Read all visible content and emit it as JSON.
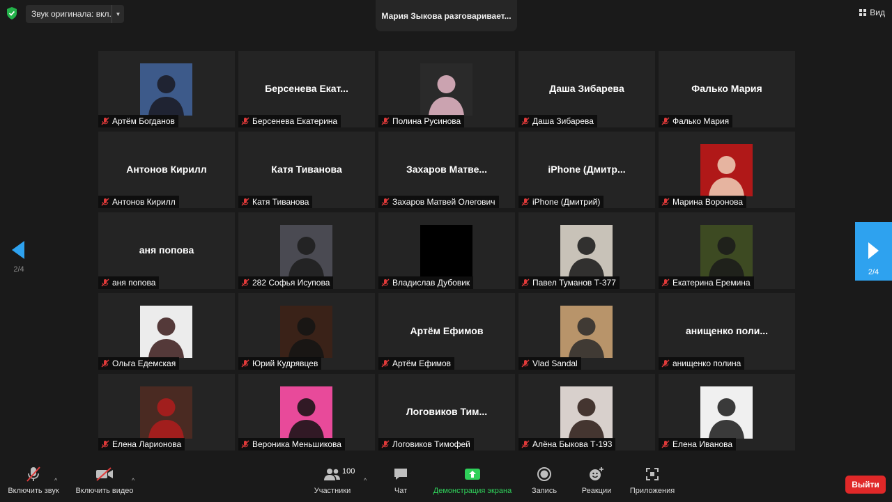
{
  "topbar": {
    "audio_label": "Звук оригинала: вкл.",
    "speaking": "Мария Зыкова разговаривает...",
    "view_label": "Вид"
  },
  "pagination": {
    "left": "2/4",
    "right": "2/4"
  },
  "participants": [
    {
      "name": "Артём Богданов",
      "display": "",
      "photo": true,
      "bg": "#3d5a8a",
      "fg": "#1a1a22"
    },
    {
      "name": "Берсенева Екатерина",
      "display": "Берсенева  Екат...",
      "photo": false
    },
    {
      "name": "Полина Русинова",
      "display": "",
      "photo": true,
      "bg": "#2a2a2a",
      "fg": "#e8b8c8"
    },
    {
      "name": "Даша Зибарева",
      "display": "Даша Зибарева",
      "photo": false
    },
    {
      "name": "Фалько Мария",
      "display": "Фалько Мария",
      "photo": false
    },
    {
      "name": "Антонов Кирилл",
      "display": "Антонов Кирилл",
      "photo": false
    },
    {
      "name": "Катя Тиванова",
      "display": "Катя Тиванова",
      "photo": false
    },
    {
      "name": "Захаров Матвей Олегович",
      "display": "Захаров  Матве...",
      "photo": false
    },
    {
      "name": "iPhone (Дмитрий)",
      "display": "iPhone  (Дмитр...",
      "photo": false
    },
    {
      "name": "Марина Воронова",
      "display": "",
      "photo": true,
      "bg": "#b01818",
      "fg": "#f0d0b8"
    },
    {
      "name": "аня попова",
      "display": "аня попова",
      "photo": false
    },
    {
      "name": "282 Софья Исупова",
      "display": "",
      "photo": true,
      "bg": "#4a4a52",
      "fg": "#1c1c1c"
    },
    {
      "name": "Владислав Дубовик",
      "display": "",
      "photo": true,
      "bg": "#000000",
      "fg": "#000000"
    },
    {
      "name": "Павел Туманов Т-377",
      "display": "",
      "photo": true,
      "bg": "#c8c2b8",
      "fg": "#161616"
    },
    {
      "name": "Екатерина Еремина",
      "display": "",
      "photo": true,
      "bg": "#3d4a22",
      "fg": "#1a1a1a"
    },
    {
      "name": "Ольга Едемская",
      "display": "",
      "photo": true,
      "bg": "#ececec",
      "fg": "#3a1a1a"
    },
    {
      "name": "Юрий Кудрявцев",
      "display": "",
      "photo": true,
      "bg": "#3a2218",
      "fg": "#141414"
    },
    {
      "name": "Артём Ефимов",
      "display": "Артём Ефимов",
      "photo": false
    },
    {
      "name": "Vlad Sandal",
      "display": "",
      "photo": true,
      "bg": "#b8946a",
      "fg": "#2a2a2a"
    },
    {
      "name": "анищенко полина",
      "display": "анищенко  поли...",
      "photo": false
    },
    {
      "name": "Елена Ларионова",
      "display": "",
      "photo": true,
      "bg": "#4a2a22",
      "fg": "#b01c1c"
    },
    {
      "name": "Вероника Меньшикова",
      "display": "",
      "photo": true,
      "bg": "#e84a9a",
      "fg": "#111111"
    },
    {
      "name": "Логовиков Тимофей",
      "display": "Логовиков  Тим...",
      "photo": false
    },
    {
      "name": "Алёна Быкова Т-193",
      "display": "",
      "photo": true,
      "bg": "#d8d0cc",
      "fg": "#2a1a14"
    },
    {
      "name": "Елена Иванова",
      "display": "",
      "photo": true,
      "bg": "#f0f0f0",
      "fg": "#1a1a1a"
    }
  ],
  "toolbar": {
    "unmute_label": "Включить звук",
    "start_video_label": "Включить видео",
    "participants_label": "Участники",
    "participants_count": "100",
    "chat_label": "Чат",
    "share_label": "Демонстрация экрана",
    "record_label": "Запись",
    "reactions_label": "Реакции",
    "apps_label": "Приложения",
    "leave_label": "Выйти"
  },
  "colors": {
    "accent": "#2ea2ef",
    "share_green": "#2fd05a",
    "leave_red": "#e02828",
    "muted_red": "#e03a3a"
  }
}
